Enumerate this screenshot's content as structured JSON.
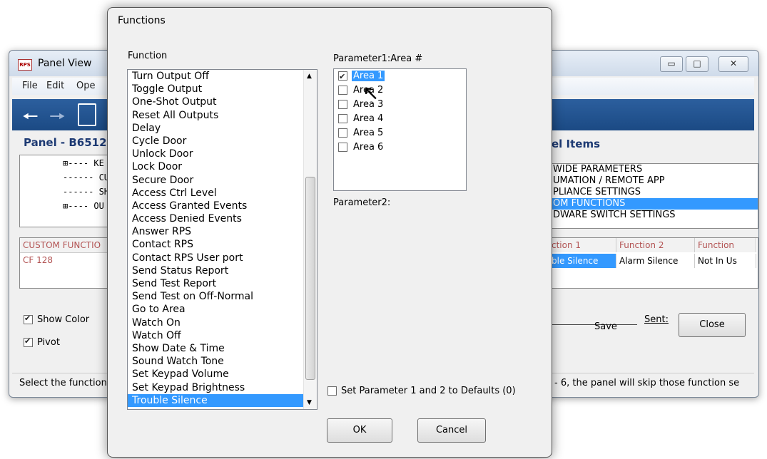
{
  "bg_window": {
    "title": "Panel View",
    "app_icon_text": "RPS",
    "menu": [
      "File",
      "Edit",
      "Ope"
    ],
    "panel_title": "Panel - B6512",
    "tree": [
      "⊞---- KE",
      "------ CU",
      "------ SH",
      "⊞---- OU"
    ],
    "panel_items_title": "el Items",
    "panel_items": [
      " WIDE PARAMETERS",
      "UMATION / REMOTE APP",
      "PLIANCE SETTINGS",
      "OM FUNCTIONS",
      "DWARE SWITCH SETTINGS"
    ],
    "panel_items_selected_index": 3,
    "left_grid_header": "CUSTOM FUNCTIO",
    "left_grid_row": "CF 128",
    "right_grid_headers": [
      "ction 1",
      "Function 2",
      "Function"
    ],
    "right_grid_row": [
      "ble Silence",
      "Alarm Silence",
      "Not In Us"
    ],
    "show_color_label": "Show Color",
    "pivot_label": "Pivot",
    "save_label": "Save",
    "sent_label": "Sent:",
    "close_label": "Close",
    "status_left": "Select the function",
    "status_right": "- 6, the panel will skip those function se"
  },
  "dialog": {
    "title": "Functions",
    "function_label": "Function",
    "functions": [
      "Turn Output Off",
      "Toggle Output",
      "One-Shot Output",
      "Reset All Outputs",
      "Delay",
      "Cycle Door",
      "Unlock Door",
      "Lock Door",
      "Secure Door",
      "Access Ctrl Level",
      "Access Granted Events",
      "Access Denied Events",
      "Answer RPS",
      "Contact RPS",
      "Contact RPS User port",
      "Send Status Report",
      "Send Test Report",
      "Send Test on Off-Normal",
      "Go to Area",
      "Watch On",
      "Watch Off",
      "Show Date & Time",
      "Sound Watch Tone",
      "Set Keypad Volume",
      "Set Keypad Brightness",
      "Trouble Silence"
    ],
    "selected_function_index": 25,
    "param1_label": "Parameter1:Area #",
    "areas": [
      "Area 1",
      "Area 2",
      "Area 3",
      "Area 4",
      "Area 5",
      "Area 6"
    ],
    "areas_checked": [
      true,
      false,
      false,
      false,
      false,
      false
    ],
    "param2_label": "Parameter2:",
    "defaults_label": "Set Parameter 1 and 2 to Defaults (0)",
    "ok_label": "OK",
    "cancel_label": "Cancel"
  },
  "colors": {
    "selection": "#3399ff",
    "toolbar": "#1f4f8c",
    "header_text": "#1d3a73"
  }
}
